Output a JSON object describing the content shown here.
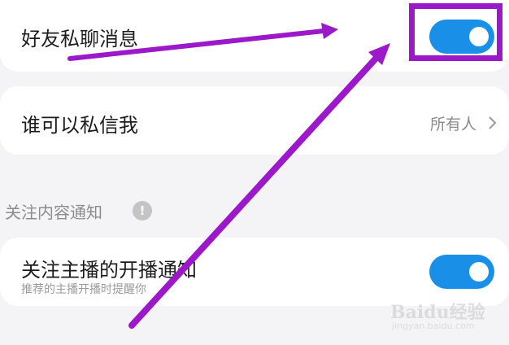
{
  "settings": {
    "friend_messages": {
      "label": "好友私聊消息",
      "enabled": true
    },
    "who_can_dm": {
      "label": "谁可以私信我",
      "value": "所有人"
    },
    "follow_section": {
      "title": "关注内容通知",
      "info_icon_glyph": "!",
      "item": {
        "label": "关注主播的开播通知",
        "description": "推荐的主播开播时提醒你",
        "enabled": true
      }
    }
  },
  "watermark": {
    "brand": "Baidu经验",
    "url": "jingyan.baidu.com"
  },
  "colors": {
    "toggle_on": "#1a8fe8",
    "annotation": "#9b19c9"
  }
}
